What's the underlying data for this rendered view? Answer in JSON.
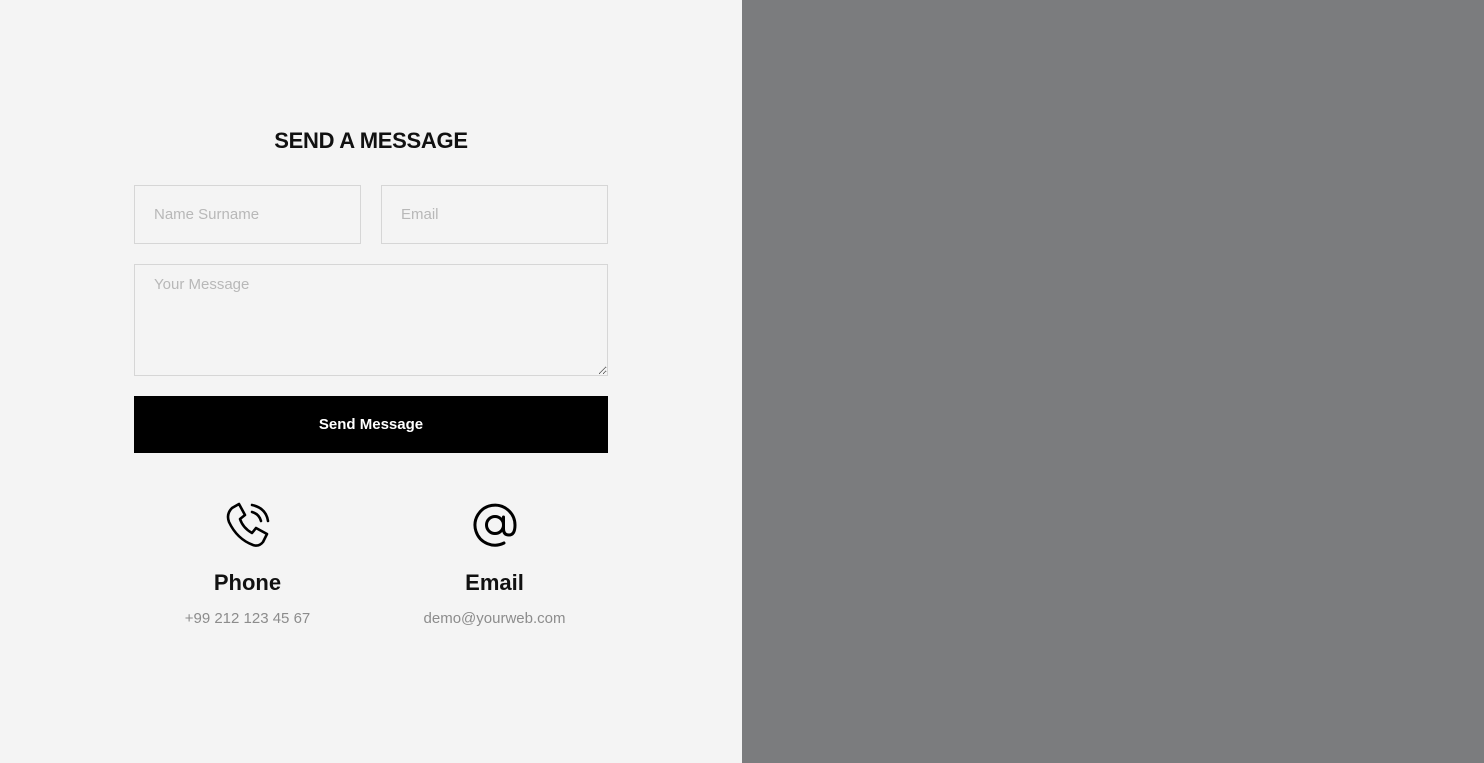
{
  "form": {
    "title": "SEND A MESSAGE",
    "name_placeholder": "Name Surname",
    "email_placeholder": "Email",
    "message_placeholder": "Your Message",
    "submit_label": "Send Message"
  },
  "contacts": [
    {
      "icon": "phone-icon",
      "label": "Phone",
      "value": "+99 212 123 45 67"
    },
    {
      "icon": "at-sign-icon",
      "label": "Email",
      "value": "demo@yourweb.com"
    }
  ],
  "colors": {
    "left_background": "#f4f4f4",
    "right_background": "#7b7c7e",
    "button_background": "#000000",
    "button_text": "#ffffff",
    "field_border": "#d6d6d6",
    "placeholder": "#b8b8b8",
    "muted_text": "#8c8c8c"
  }
}
